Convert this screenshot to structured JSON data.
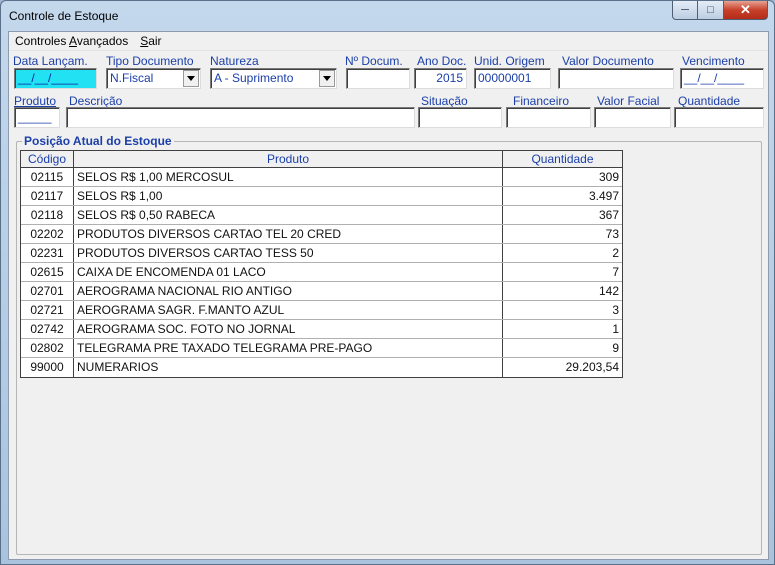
{
  "window": {
    "title": "Controle de Estoque",
    "controls": {
      "minimize": "─",
      "maximize": "□",
      "close": "✕"
    }
  },
  "menu": {
    "items": [
      {
        "prefix": "Controles ",
        "accel": "A",
        "suffix": "vançados"
      },
      {
        "prefix": "",
        "accel": "S",
        "suffix": "air"
      }
    ]
  },
  "form": {
    "row1": {
      "data_lancamento": {
        "label": "Data Lançam.",
        "value": "__/__/____"
      },
      "tipo_documento": {
        "label": "Tipo Documento",
        "value": "N.Fiscal"
      },
      "natureza": {
        "label": "Natureza",
        "value": "A - Suprimento"
      },
      "numero_documento": {
        "label": "Nº Docum.",
        "value": ""
      },
      "ano_documento": {
        "label": "Ano Doc.",
        "value": "2015"
      },
      "unidade_origem": {
        "label": "Unid. Origem",
        "value": "00000001"
      },
      "valor_documento": {
        "label": "Valor Documento",
        "value": ""
      },
      "vencimento": {
        "label": "Vencimento",
        "value": "__/__/____"
      }
    },
    "row2": {
      "produto": {
        "label": "Produto",
        "value": "_____"
      },
      "descricao": {
        "label": "Descrição",
        "value": ""
      },
      "situacao": {
        "label": "Situação",
        "value": ""
      },
      "financeiro": {
        "label": "Financeiro",
        "value": ""
      },
      "valor_facial": {
        "label": "Valor Facial",
        "value": ""
      },
      "quantidade": {
        "label": "Quantidade",
        "value": ""
      }
    }
  },
  "stock": {
    "title": "Posição Atual do Estoque",
    "columns": [
      "Código",
      "Produto",
      "Quantidade"
    ],
    "rows": [
      [
        "02115",
        "SELOS R$ 1,00 MERCOSUL",
        "309"
      ],
      [
        "02117",
        "SELOS R$ 1,00",
        "3.497"
      ],
      [
        "02118",
        "SELOS R$ 0,50 RABECA",
        "367"
      ],
      [
        "02202",
        "PRODUTOS DIVERSOS CARTAO TEL 20 CRED",
        "73"
      ],
      [
        "02231",
        "PRODUTOS DIVERSOS CARTAO TESS 50",
        "2"
      ],
      [
        "02615",
        "CAIXA DE ENCOMENDA 01 LACO",
        "7"
      ],
      [
        "02701",
        "AEROGRAMA NACIONAL RIO ANTIGO",
        "142"
      ],
      [
        "02721",
        "AEROGRAMA SAGR. F.MANTO AZUL",
        "3"
      ],
      [
        "02742",
        "AEROGRAMA SOC. FOTO NO JORNAL",
        "1"
      ],
      [
        "02802",
        "TELEGRAMA PRE TAXADO TELEGRAMA PRE-PAGO",
        "9"
      ],
      [
        "99000",
        "NUMERARIOS",
        "29.203,54"
      ]
    ]
  },
  "colors": {
    "label_blue": "#1b3fa8",
    "focused_field": "#22e1f2",
    "close_red": "#c7402a"
  }
}
